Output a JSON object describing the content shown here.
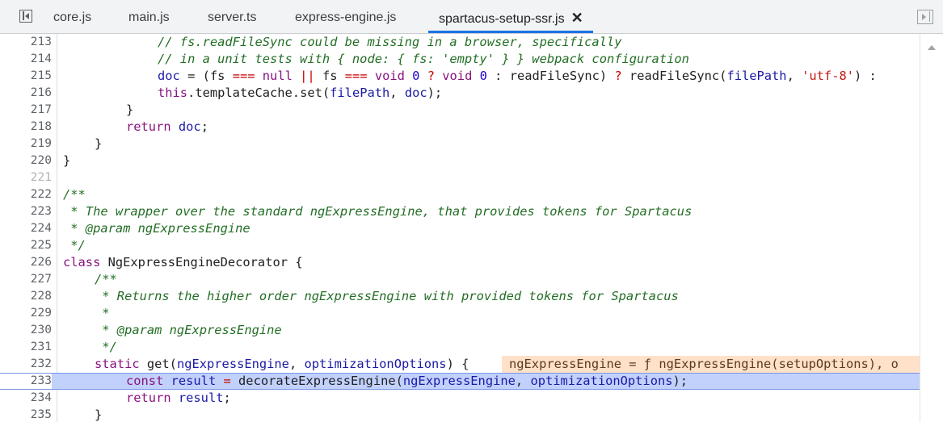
{
  "tabs": [
    {
      "label": "core.js"
    },
    {
      "label": "main.js"
    },
    {
      "label": "server.ts"
    },
    {
      "label": "express-engine.js"
    },
    {
      "label": "spartacus-setup-ssr.js",
      "active": true,
      "close": "✕"
    }
  ],
  "editor": {
    "lines": [
      {
        "n": "213"
      },
      {
        "n": "214"
      },
      {
        "n": "215"
      },
      {
        "n": "216"
      },
      {
        "n": "217"
      },
      {
        "n": "218"
      },
      {
        "n": "219"
      },
      {
        "n": "220"
      },
      {
        "n": "221"
      },
      {
        "n": "222"
      },
      {
        "n": "223"
      },
      {
        "n": "224"
      },
      {
        "n": "225"
      },
      {
        "n": "226"
      },
      {
        "n": "227"
      },
      {
        "n": "228"
      },
      {
        "n": "229"
      },
      {
        "n": "230"
      },
      {
        "n": "231"
      },
      {
        "n": "232"
      },
      {
        "n": "233"
      },
      {
        "n": "234"
      },
      {
        "n": "235"
      }
    ],
    "code": {
      "l213": "// fs.readFileSync could be missing in a browser, specifically",
      "l214": "// in a unit tests with { node: { fs: 'empty' } } webpack configuration",
      "l215_doc": "doc",
      "l215_eq": " = (",
      "l215_fs1": "fs",
      "l215_teq1": " === ",
      "l215_null": "null",
      "l215_or": " || ",
      "l215_fs2": "fs",
      "l215_teq2": " === ",
      "l215_void1": "void",
      "l215_zero1": " 0",
      "l215_q1": " ? ",
      "l215_void2": "void",
      "l215_zero2": " 0",
      "l215_rest1": " : readFileSync) ",
      "l215_q2": "?",
      "l215_rest2": " readFileSync(",
      "l215_fp": "filePath",
      "l215_comma": ", ",
      "l215_str": "'utf-8'",
      "l215_end": ") :",
      "l216_this": "this",
      "l216_mid": ".templateCache.set(",
      "l216_fp": "filePath",
      "l216_comma": ", ",
      "l216_doc": "doc",
      "l216_end": ");",
      "l217": "}",
      "l218_ret": "return",
      "l218_doc": " doc",
      "l218_end": ";",
      "l219": "}",
      "l220": "}",
      "l222": "/**",
      "l223": " * The wrapper over the standard ngExpressEngine, that provides tokens for Spartacus",
      "l224": " * @param ngExpressEngine",
      "l225": " */",
      "l226_class": "class",
      "l226_name": " NgExpressEngineDecorator {",
      "l227": "/**",
      "l228": " * Returns the higher order ngExpressEngine with provided tokens for Spartacus",
      "l229": " *",
      "l230": " * @param ngExpressEngine",
      "l231": " */",
      "l232_static": "static",
      "l232_get": " get(",
      "l232_p1": "ngExpressEngine",
      "l232_comma": ", ",
      "l232_p2": "optimizationOptions",
      "l232_end": ") {",
      "l232_inline": "ngExpressEngine = ƒ ngExpressEngine(setupOptions), o",
      "l233_const": "const",
      "l233_res": " result",
      "l233_eq": " = ",
      "l233_fn": "decorateExpressEngine(",
      "l233_p1": "ngExpressEngine",
      "l233_comma": ", ",
      "l233_p2": "optimizationOptions",
      "l233_end": ");",
      "l234_ret": "return",
      "l234_res": " result",
      "l234_end": ";",
      "l235": "}"
    }
  },
  "colors": {
    "accent": "#1a73e8",
    "current_line": "#c2d1fb",
    "inline_value_bg": "#ffe0c8"
  },
  "icons": {
    "left": "navigator-toggle-icon",
    "right": "debugger-toggle-icon"
  }
}
